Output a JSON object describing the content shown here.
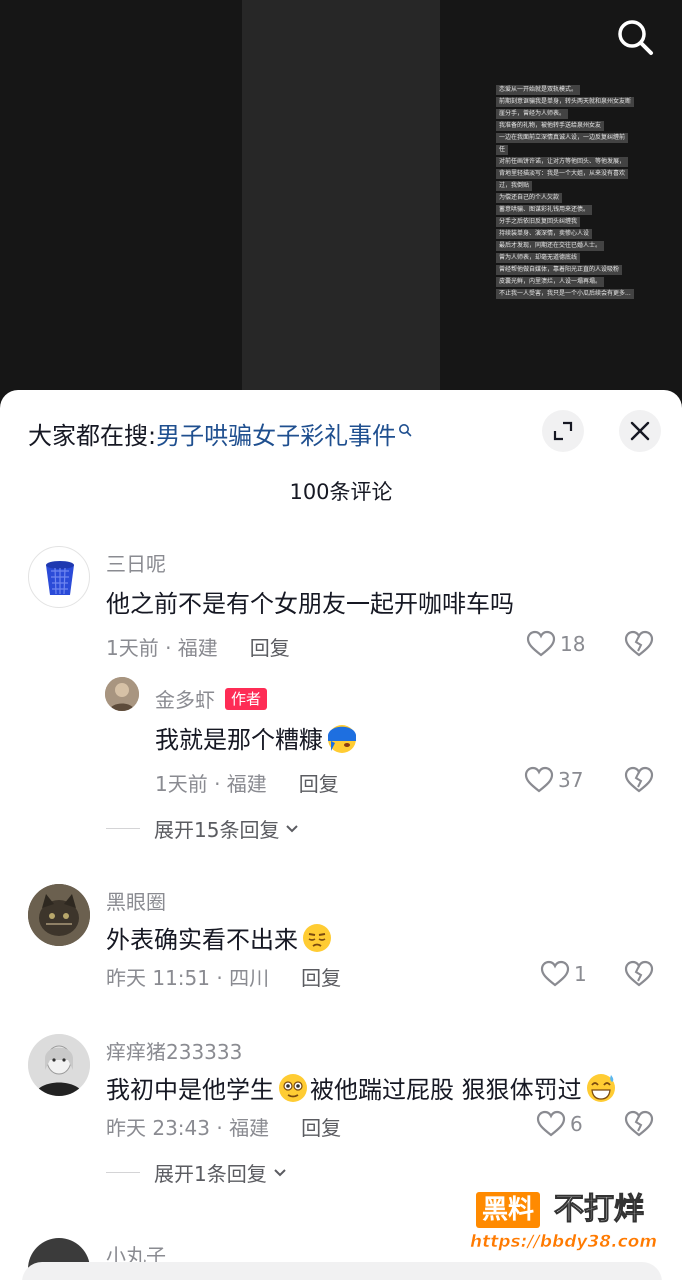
{
  "video": {
    "overlay_lines": [
      "恋爱从一开始就是双轨模式。",
      "前期刻意诓骗我是单身，转头两天就和泉州女友断",
      "崖分手，曾经为人师表。",
      "我准备的礼物，被他转手送给泉州女友",
      "一边在我面前立深情真诚人设，一边反复纠缠前",
      "任",
      "对前任画饼许诺，让对方等他回头、等他发展，",
      "背地里轻描淡写：我是一个大姐，从来没有喜欢",
      "过，我倒贴",
      "为偿还自己的个人欠款",
      "蓄意哄骗、图谋彩礼钱用来还债。",
      "分手之后依旧反复回头纠缠我",
      "持续装单身、演深情，卖惨心人设",
      "最后才发现，同期还在交往已婚人士。",
      "曾为人师表，却毫无道德底线",
      "曾经帮他做自媒体，靠着阳光正直的人设吸粉",
      "皮囊光鲜，内里溃烂，人设一塌再塌。",
      "不止我一人受害，我只是一个小瓜后续会有更多..."
    ]
  },
  "header": {
    "hot_search_prefix": "大家都在搜:",
    "hot_search_keyword": "男子哄骗女子彩礼事件",
    "comment_count": "100条评论"
  },
  "comments": [
    {
      "username": "三日呢",
      "text": "他之前不是有个女朋友一起开咖啡车吗",
      "time_location": "1天前 · 福建",
      "reply_label": "回复",
      "likes": "18",
      "reply": {
        "username": "金多虾",
        "badge": "作者",
        "text": "我就是那个糟糠",
        "time_location": "1天前 · 福建",
        "reply_label": "回复",
        "likes": "37"
      },
      "expand_label": "展开15条回复"
    },
    {
      "username": "黑眼圈",
      "text": "外表确实看不出来",
      "time_location": "昨天 11:51 · 四川",
      "reply_label": "回复",
      "likes": "1"
    },
    {
      "username": "痒痒猪233333",
      "text": "我初中是他学生",
      "text_mid": "被他踹过屁股 狠狠体罚过",
      "time_location": "昨天 23:43 · 福建",
      "reply_label": "回复",
      "likes": "6",
      "expand_label": "展开1条回复"
    },
    {
      "username": "小丸子"
    }
  ],
  "watermark": {
    "badge": "黑料",
    "text": "不打烊",
    "url": "https://bbdy38.com"
  },
  "colors": {
    "keyword": "#1f4f8f",
    "author_badge": "#fe2c55",
    "watermark_orange": "#ff8a00"
  }
}
